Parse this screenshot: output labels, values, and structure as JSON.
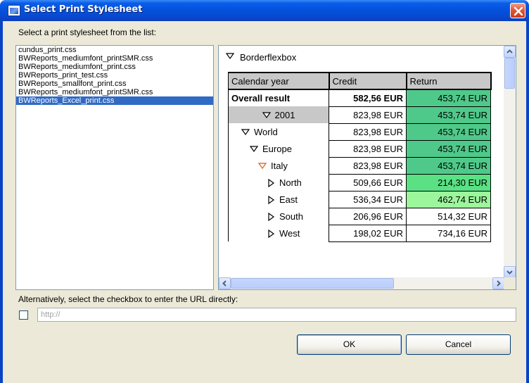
{
  "window": {
    "title": "Select Print Stylesheet"
  },
  "labels": {
    "list_prompt": "Select a print stylesheet from the list:",
    "url_prompt": "Alternatively, select the checkbox to enter the URL directly:"
  },
  "stylesheets": [
    {
      "name": "cundus_print.css",
      "selected": false
    },
    {
      "name": "BWReports_mediumfont_printSMR.css",
      "selected": false
    },
    {
      "name": "BWReports_mediumfont_print.css",
      "selected": false
    },
    {
      "name": "BWReports_print_test.css",
      "selected": false
    },
    {
      "name": "BWReports_smallfont_print.css",
      "selected": false
    },
    {
      "name": "BWReports_mediumfont_printSMR.css",
      "selected": false
    },
    {
      "name": "BWReports_Excel_print.css",
      "selected": true
    }
  ],
  "preview": {
    "box_title": "Borderflexbox",
    "columns": [
      "Calendar year",
      "Credit",
      "Return"
    ],
    "overall_label": "Overall result",
    "overall_credit": "582,56 EUR",
    "overall_return": "453,74 EUR",
    "rows": [
      {
        "label": "2001",
        "credit": "823,98 EUR",
        "return": "453,74 EUR"
      },
      {
        "label": "World",
        "credit": "823,98 EUR",
        "return": "453,74 EUR"
      },
      {
        "label": "Europe",
        "credit": "823,98 EUR",
        "return": "453,74 EUR"
      },
      {
        "label": "Italy",
        "credit": "823,98 EUR",
        "return": "453,74 EUR"
      },
      {
        "label": "North",
        "credit": "509,66 EUR",
        "return": "214,30 EUR"
      },
      {
        "label": "East",
        "credit": "536,34 EUR",
        "return": "462,74 EUR"
      },
      {
        "label": "South",
        "credit": "206,96 EUR",
        "return": "514,32 EUR"
      },
      {
        "label": "West",
        "credit": "198,02 EUR",
        "return": "734,16 EUR"
      }
    ]
  },
  "url": {
    "checked": false,
    "value": "http://"
  },
  "buttons": {
    "ok": "OK",
    "cancel": "Cancel"
  },
  "colors": {
    "titlebar": "#0451db",
    "selection": "#316ac5",
    "return_green_dark": "#4fc98a",
    "return_green_mid": "#59e183",
    "return_green_light": "#9cf69c",
    "header_gray": "#c8c8c8",
    "triangle_orange": "#e0703a"
  }
}
